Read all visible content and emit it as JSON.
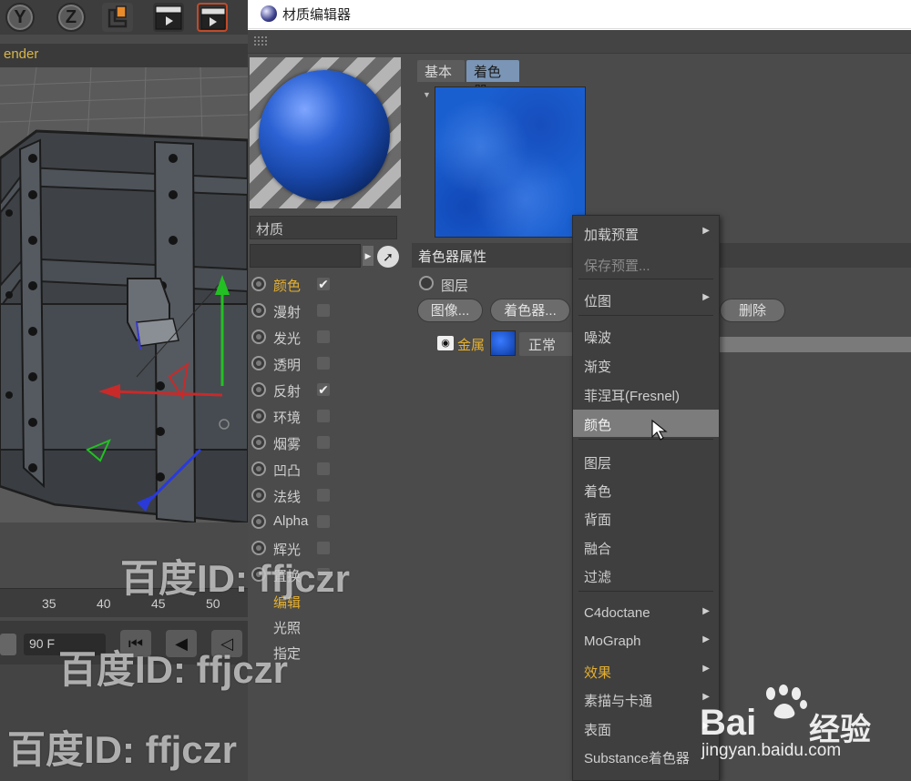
{
  "toolbar": {
    "axis_y": "Y",
    "axis_z": "Z"
  },
  "viewport": {
    "render_label": "ender",
    "timeline_ticks": [
      "35",
      "40",
      "45",
      "50"
    ],
    "frame_field": "90 F"
  },
  "editor": {
    "title": "材质编辑器",
    "material_name_label": "材质",
    "channels": [
      {
        "label": "颜色",
        "checked": true,
        "active": true
      },
      {
        "label": "漫射",
        "checked": false,
        "active": false
      },
      {
        "label": "发光",
        "checked": false,
        "active": false
      },
      {
        "label": "透明",
        "checked": false,
        "active": false
      },
      {
        "label": "反射",
        "checked": true,
        "active": false
      },
      {
        "label": "环境",
        "checked": false,
        "active": false
      },
      {
        "label": "烟雾",
        "checked": false,
        "active": false
      },
      {
        "label": "凹凸",
        "checked": false,
        "active": false
      },
      {
        "label": "法线",
        "checked": false,
        "active": false
      },
      {
        "label": "Alpha",
        "checked": false,
        "active": false
      },
      {
        "label": "辉光",
        "checked": false,
        "active": false
      },
      {
        "label": "置换",
        "checked": false,
        "active": false
      }
    ],
    "extra_items": [
      {
        "label": "编辑",
        "active": true
      },
      {
        "label": "光照",
        "active": false
      },
      {
        "label": "指定",
        "active": false
      }
    ],
    "tabs": {
      "basic": "基本",
      "shader": "着色器"
    },
    "props_title": "着色器属性",
    "layer_label": "图层",
    "buttons": {
      "image": "图像...",
      "shader": "着色器...",
      "delete": "删除"
    },
    "layer": {
      "name": "金属",
      "blend": "正常"
    }
  },
  "context_menu": {
    "items": [
      {
        "label": "加载预置",
        "submenu": true,
        "disabled": false
      },
      {
        "label": "保存预置...",
        "submenu": false,
        "disabled": true
      },
      {
        "label": "位图",
        "submenu": true,
        "disabled": false
      },
      {
        "label": "噪波",
        "submenu": false,
        "disabled": false
      },
      {
        "label": "渐变",
        "submenu": false,
        "disabled": false
      },
      {
        "label": "菲涅耳(Fresnel)",
        "submenu": false,
        "disabled": false
      },
      {
        "label": "颜色",
        "submenu": false,
        "disabled": false,
        "hover": true
      },
      {
        "label": "图层",
        "submenu": false,
        "disabled": false
      },
      {
        "label": "着色",
        "submenu": false,
        "disabled": false
      },
      {
        "label": "背面",
        "submenu": false,
        "disabled": false
      },
      {
        "label": "融合",
        "submenu": false,
        "disabled": false
      },
      {
        "label": "过滤",
        "submenu": false,
        "disabled": false
      },
      {
        "label": "C4doctane",
        "submenu": true,
        "disabled": false
      },
      {
        "label": "MoGraph",
        "submenu": true,
        "disabled": false
      },
      {
        "label": "效果",
        "submenu": true,
        "disabled": false,
        "accent": true
      },
      {
        "label": "素描与卡通",
        "submenu": true,
        "disabled": false
      },
      {
        "label": "表面",
        "submenu": true,
        "disabled": false
      },
      {
        "label": "Substance着色器",
        "submenu": false,
        "disabled": false
      }
    ]
  },
  "watermarks": {
    "id_text": "百度ID: ffjczr",
    "baidu_text": "Bai",
    "baidu_jingyan": "经验",
    "baidu_url": "jingyan.baidu.com"
  },
  "colors": {
    "accent_orange": "#e5b030",
    "panel_bg": "#4b4b4b",
    "menu_hover": "#7c7c7c",
    "preview_blue": "#1a5fd0"
  }
}
